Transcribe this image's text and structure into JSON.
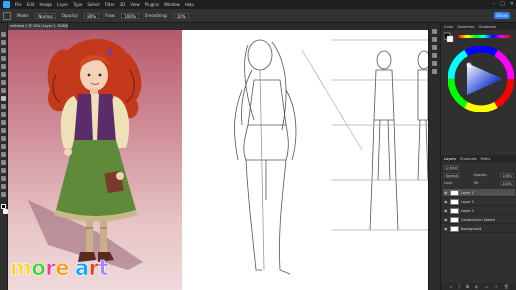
{
  "menubar": {
    "items": [
      "File",
      "Edit",
      "Image",
      "Layer",
      "Type",
      "Select",
      "Filter",
      "3D",
      "View",
      "Plugins",
      "Window",
      "Help"
    ],
    "window_controls": [
      "–",
      "□",
      "✕"
    ]
  },
  "options": {
    "mode_label": "Mode:",
    "mode_value": "Normal",
    "opacity_label": "Opacity:",
    "opacity_value": "80%",
    "flow_label": "Flow:",
    "flow_value": "100%",
    "smoothing_label": "Smoothing:",
    "smoothing_value": "10%",
    "share_label": "Share"
  },
  "document": {
    "tab_title": "redhead 1 @ 33% (Layer 1, RGB/8) ×"
  },
  "color_panel": {
    "tabs": [
      "Color",
      "Swatches",
      "Gradients",
      "Patterns"
    ]
  },
  "layers_panel": {
    "tabs": [
      "Layers",
      "Channels",
      "Paths"
    ],
    "kind_label": "Q Kind",
    "blend_value": "Normal",
    "opacity_label": "Opacity:",
    "opacity_value": "100%",
    "lock_label": "Lock:",
    "fill_label": "Fill:",
    "fill_value": "100%",
    "layers": [
      {
        "name": "Layer 1",
        "selected": true
      },
      {
        "name": "Layer 3",
        "selected": false
      },
      {
        "name": "Layer 2",
        "selected": false
      },
      {
        "name": "Construction Sketch",
        "selected": false
      },
      {
        "name": "Background",
        "selected": false
      }
    ],
    "footer_icons": [
      "link-icon",
      "fx-icon",
      "mask-icon",
      "adjustment-icon",
      "folder-icon",
      "new-layer-icon",
      "trash-icon"
    ]
  },
  "watermark": {
    "word1": "more",
    "word2": "art",
    "colors": [
      "#ffd43b",
      "#4cd137",
      "#e84393",
      "#f39c12",
      "#00a8ff",
      "#e84118",
      "#9c88ff"
    ]
  },
  "colors": {
    "accent": "#2f80ed",
    "ui_bg": "#282828",
    "painting_bg": "#c97889",
    "hair": "#c4391c",
    "skirt": "#5e8a3a",
    "vest": "#5a2d6a"
  }
}
